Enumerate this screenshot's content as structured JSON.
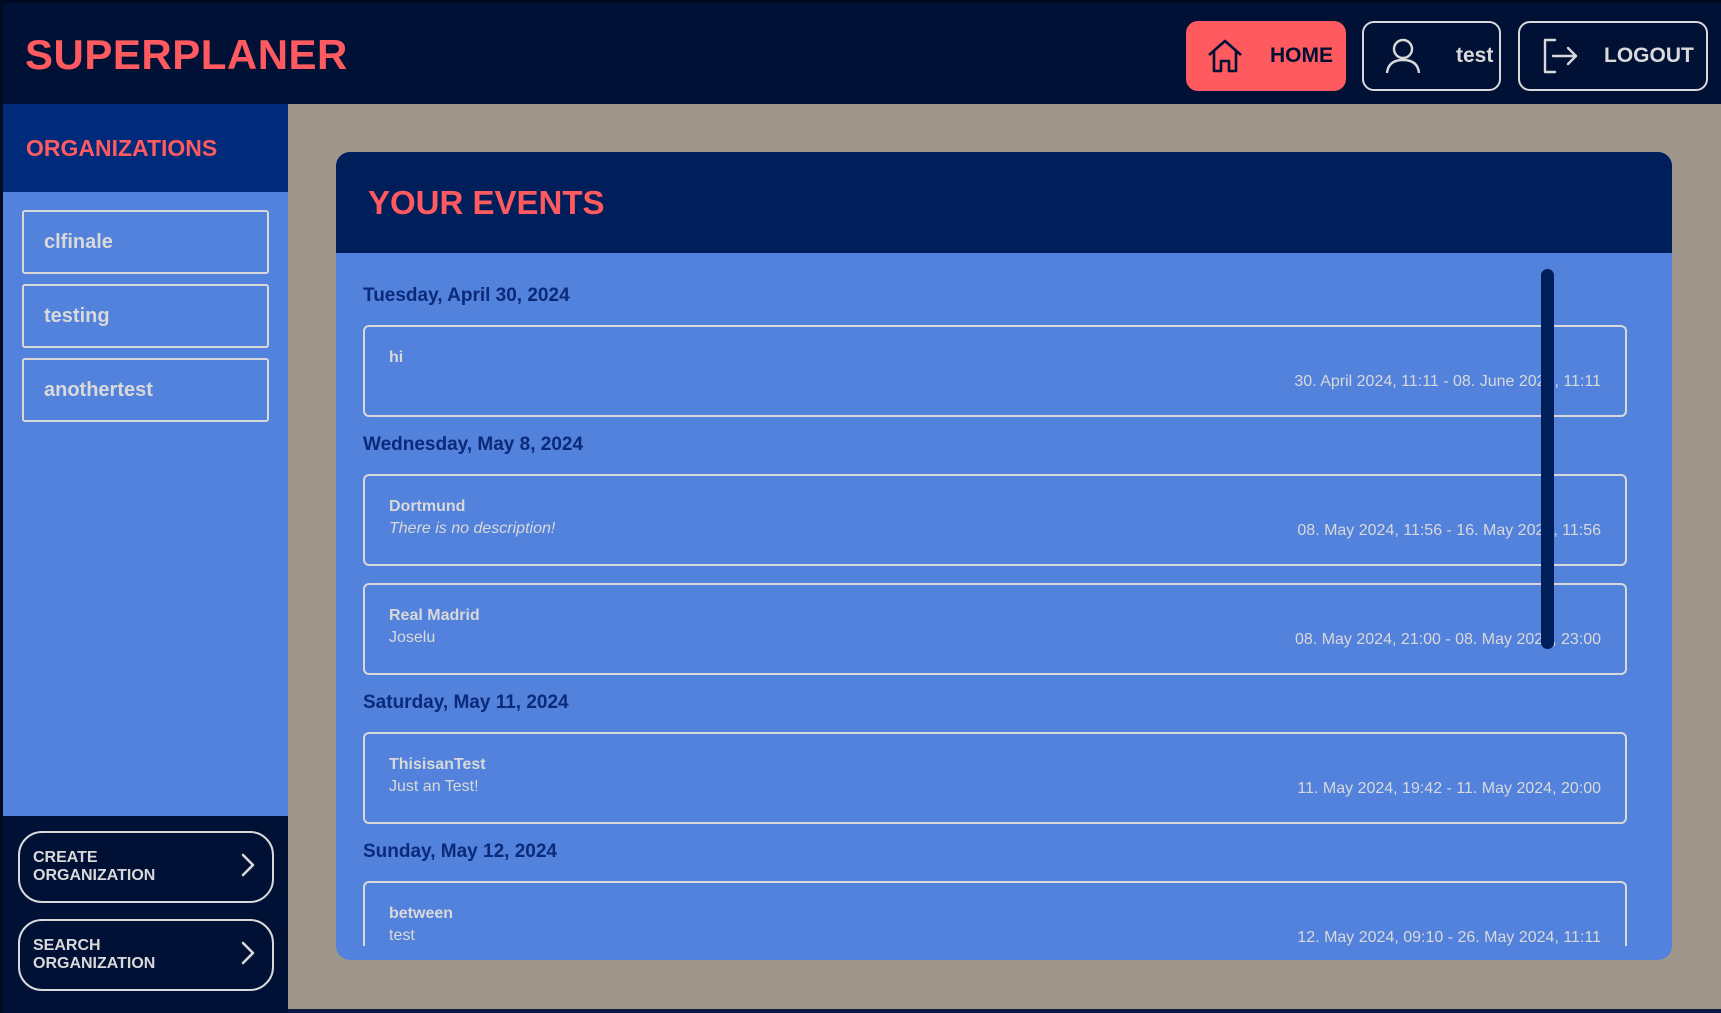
{
  "header": {
    "brand": "SUPERPLANER",
    "home_label": "HOME",
    "user_label": "test",
    "logout_label": "LOGOUT"
  },
  "sidebar": {
    "title": "ORGANIZATIONS",
    "organizations": [
      {
        "label": "clfinale"
      },
      {
        "label": "testing"
      },
      {
        "label": "anothertest"
      }
    ],
    "create_label": "CREATE\nORGANIZATION",
    "search_label": "SEARCH\nORGANIZATION"
  },
  "main": {
    "title": "YOUR EVENTS",
    "days": [
      {
        "label": "Tuesday, April 30, 2024",
        "events": [
          {
            "title": "hi",
            "description": "",
            "time": "30. April 2024, 11:11 - 08. June 2024, 11:11"
          }
        ]
      },
      {
        "label": "Wednesday, May 8, 2024",
        "events": [
          {
            "title": "Dortmund",
            "description": "There is no description!",
            "time": "08. May 2024, 11:56 - 16. May 2024, 11:56"
          },
          {
            "title": "Real Madrid",
            "description": "Joselu",
            "time": "08. May 2024, 21:00 - 08. May 2024, 23:00"
          }
        ]
      },
      {
        "label": "Saturday, May 11, 2024",
        "events": [
          {
            "title": "ThisisanTest",
            "description": "Just an Test!",
            "time": "11. May 2024, 19:42 - 11. May 2024, 20:00"
          }
        ]
      },
      {
        "label": "Sunday, May 12, 2024",
        "events": [
          {
            "title": "between",
            "description": "test",
            "time": "12. May 2024, 09:10 - 26. May 2024, 11:11"
          }
        ]
      }
    ]
  },
  "colors": {
    "accent": "#ff5a5f",
    "navy": "#001135",
    "panel_blue": "#5282dc",
    "background": "#a0958b"
  },
  "icons": {
    "home": "home-icon",
    "user": "user-icon",
    "logout": "logout-icon",
    "chevron": "chevron-right-icon"
  }
}
